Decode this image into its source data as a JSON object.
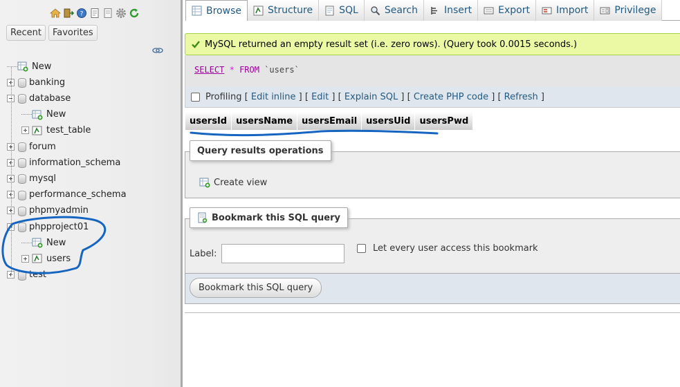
{
  "left": {
    "top_icons": [
      "home-icon",
      "exit-icon",
      "help-icon",
      "docs-icon",
      "sql-docs-icon",
      "settings-icon",
      "reload-icon"
    ],
    "tabs": [
      {
        "label": "Recent"
      },
      {
        "label": "Favorites"
      }
    ],
    "tree": [
      {
        "label": "New",
        "level": 0,
        "kind": "new"
      },
      {
        "label": "banking",
        "level": 0,
        "kind": "db",
        "expander": "plus"
      },
      {
        "label": "database",
        "level": 0,
        "kind": "db",
        "expander": "minus"
      },
      {
        "label": "New",
        "level": 1,
        "kind": "new"
      },
      {
        "label": "test_table",
        "level": 1,
        "kind": "table",
        "expander": "plus"
      },
      {
        "label": "forum",
        "level": 0,
        "kind": "db",
        "expander": "plus"
      },
      {
        "label": "information_schema",
        "level": 0,
        "kind": "db",
        "expander": "plus"
      },
      {
        "label": "mysql",
        "level": 0,
        "kind": "db",
        "expander": "plus"
      },
      {
        "label": "performance_schema",
        "level": 0,
        "kind": "db",
        "expander": "plus"
      },
      {
        "label": "phpmyadmin",
        "level": 0,
        "kind": "db",
        "expander": "plus"
      },
      {
        "label": "phpproject01",
        "level": 0,
        "kind": "db",
        "expander": "minus"
      },
      {
        "label": "New",
        "level": 1,
        "kind": "new"
      },
      {
        "label": "users",
        "level": 1,
        "kind": "table",
        "expander": "plus"
      },
      {
        "label": "test",
        "level": 0,
        "kind": "db",
        "expander": "plus"
      }
    ]
  },
  "menu": {
    "tabs": [
      {
        "label": "Browse",
        "icon": "browse-icon",
        "active": true
      },
      {
        "label": "Structure",
        "icon": "structure-icon"
      },
      {
        "label": "SQL",
        "icon": "sql-icon"
      },
      {
        "label": "Search",
        "icon": "search-icon"
      },
      {
        "label": "Insert",
        "icon": "insert-icon"
      },
      {
        "label": "Export",
        "icon": "export-icon"
      },
      {
        "label": "Import",
        "icon": "import-icon"
      },
      {
        "label": "Privilege",
        "icon": "privileges-icon"
      }
    ]
  },
  "message": {
    "text": "MySQL returned an empty result set (i.e. zero rows). (Query took 0.0015 seconds.)"
  },
  "sql": {
    "select": "SELECT",
    "star": "*",
    "from": "FROM",
    "table": "`users`"
  },
  "tools": {
    "profiling": "Profiling",
    "edit_inline": "Edit inline",
    "edit": "Edit",
    "explain": "Explain SQL",
    "create_php": "Create PHP code",
    "refresh": "Refresh",
    "open_bracket": "[",
    "close_bracket": "]",
    "separator": "] ["
  },
  "columns": [
    "usersId",
    "usersName",
    "usersEmail",
    "usersUid",
    "usersPwd"
  ],
  "query_ops": {
    "legend": "Query results operations",
    "create_view": "Create view"
  },
  "bookmark": {
    "legend": "Bookmark this SQL query",
    "label": "Label:",
    "label_value": "",
    "share": "Let every user access this bookmark",
    "button": "Bookmark this SQL query"
  },
  "colors": {
    "success_bg": "#ebf8a4",
    "link": "#235a81",
    "annotation": "#1565c0"
  }
}
